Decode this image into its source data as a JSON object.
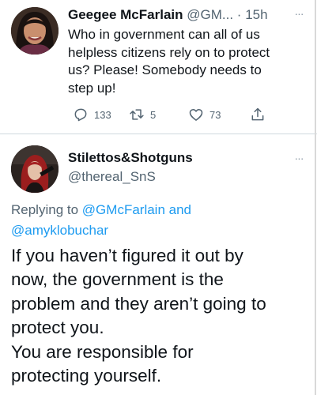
{
  "tweet1": {
    "display_name": "Geegee McFarlain",
    "handle": "@GM...",
    "dot": "·",
    "time": "15h",
    "text_lines": [
      "Who in government can all of us",
      "helpless citizens rely on to protect",
      "us? Please! Somebody needs to",
      "step up!"
    ],
    "stats": {
      "replies": "133",
      "retweets": "5",
      "likes": "73"
    }
  },
  "tweet2": {
    "display_name": "Stilettos&Shotguns",
    "handle": "@thereal_SnS",
    "replying_prefix": "Replying to",
    "replying_to_1": "@GMcFarlain",
    "replying_and": "and",
    "replying_to_2": "@amyklobuchar",
    "text_lines": [
      "If you haven’t figured it out by",
      "now,  the government is the",
      "problem and they aren’t going to",
      "protect you.",
      "You are responsible for",
      "protecting yourself."
    ]
  },
  "more_glyph": "···",
  "colors": {
    "text": "#0f1419",
    "secondary": "#536471",
    "link": "#1d9bf0",
    "divider": "#cfd9de"
  },
  "icons": {
    "reply": "reply-icon",
    "retweet": "retweet-icon",
    "like": "heart-icon",
    "share": "share-icon",
    "more": "more-icon"
  }
}
